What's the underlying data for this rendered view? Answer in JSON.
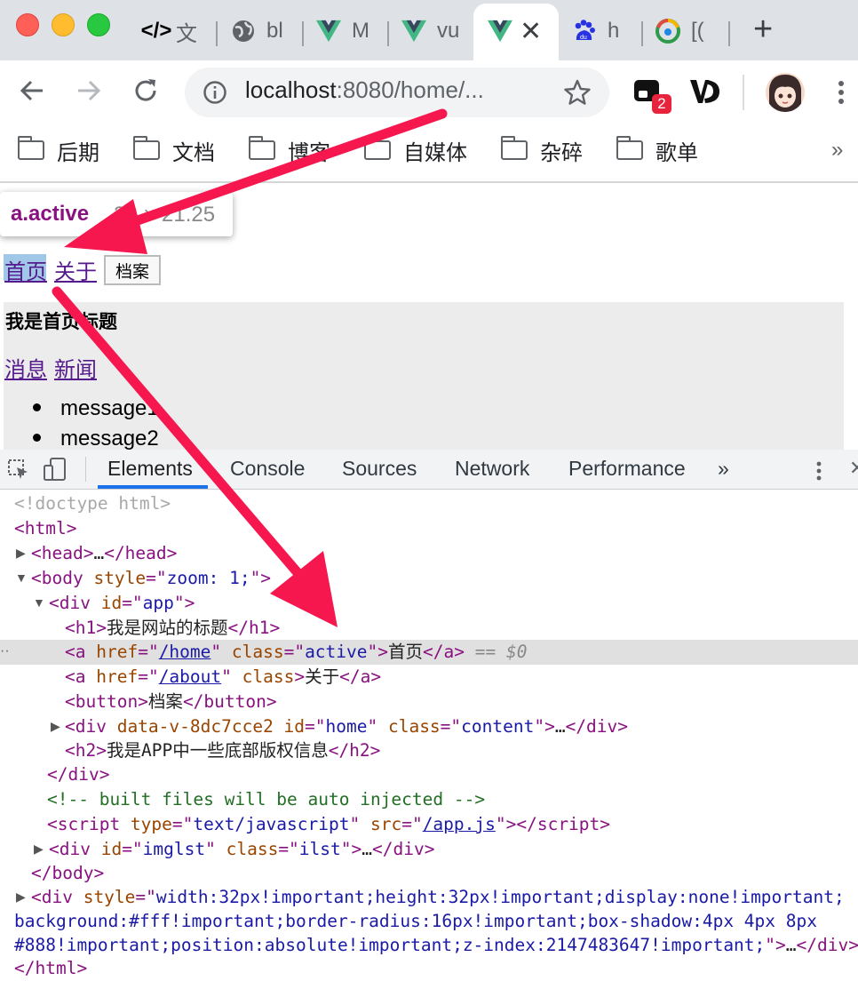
{
  "browser": {
    "tabs": [
      {
        "icon": "code-icon",
        "label": "文"
      },
      {
        "icon": "globe-icon",
        "label": "bl"
      },
      {
        "icon": "vue-icon",
        "label": "M"
      },
      {
        "icon": "vue-icon",
        "label": "vu"
      },
      {
        "icon": "vue-icon",
        "label": "",
        "active": true
      },
      {
        "icon": "baidu-icon",
        "label": "h"
      },
      {
        "icon": "chrome-qq-icon",
        "label": "[("
      }
    ],
    "new_tab": "+",
    "url_host": "localhost",
    "url_path": ":8080/home/...",
    "extension_badge": "2",
    "bookmarks": [
      "后期",
      "文档",
      "博客",
      "自媒体",
      "杂碎",
      "歌单"
    ],
    "bookmarks_more": "»"
  },
  "page": {
    "tooltip_selector": "a.active",
    "tooltip_dims": "32 × 21.25",
    "nav_home": "首页",
    "nav_about": "关于",
    "archive_button": "档案",
    "heading": "我是首页标题",
    "sub_messages": "消息",
    "sub_news": "新闻",
    "list": [
      "message1",
      "message2"
    ]
  },
  "devtools": {
    "tabs": [
      "Elements",
      "Console",
      "Sources",
      "Network",
      "Performance"
    ],
    "more": "»",
    "selected_marker": "== $0"
  },
  "colors": {
    "arrow": "#f5174e",
    "highlight": "#6fa8dc",
    "accent": "#1a73e8"
  }
}
